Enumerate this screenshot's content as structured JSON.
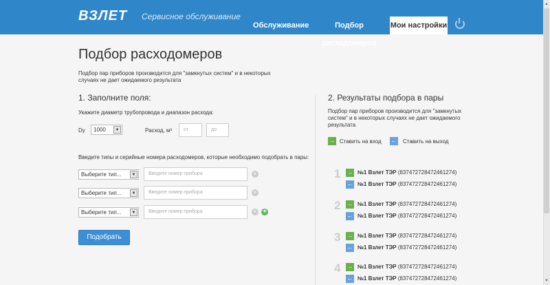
{
  "header": {
    "logo": "ВЗЛЕТ",
    "subtitle": "Сервисное обслуживание",
    "nav": [
      "Обслуживание",
      "Подбор расходомеров",
      "Мои настройки"
    ],
    "active_nav": "Мои настройки"
  },
  "page": {
    "title": "Подбор расходомеров",
    "lead": "Подбор пар приборов производится для \"замкнутых систем\" и в некоторых случаях не дает ожидаемого результата"
  },
  "left": {
    "heading": "1. Заполните поля:",
    "diameter_prompt": "Укажите диаметр трубопровода и диапазон расхода:",
    "dy_label": "Dy",
    "dy_value": "1000",
    "flow_label": "Расход, м³",
    "from_placeholder": "от",
    "to_placeholder": "до",
    "types_prompt": "Введите типы и серийные номера расходомеров, которые необходимо подобрать в пары:",
    "rows": [
      {
        "type": "Выберите тип...",
        "placeholder": "Введите номер прибора"
      },
      {
        "type": "Выберите тип...",
        "placeholder": "Введите номер прибора"
      },
      {
        "type": "Выберите тип...",
        "placeholder": "Введите номер прибора"
      }
    ],
    "clear_symbol": "×",
    "add_symbol": "+",
    "submit": "Подобрать"
  },
  "right": {
    "heading": "2. Результаты подбора в пары",
    "note": "Подбор пар приборов производится для \"замкнутых систем\" и в некоторых случаях не дает ожидаемого результата",
    "legend_in": "Ставить на вход",
    "legend_out": "Ставить на выход",
    "in_arrow": "→",
    "out_arrow": "←",
    "pairs": [
      {
        "num": "1",
        "in_name": "№1 Взлет ТЭР",
        "in_serial": "(837472728472461274)",
        "out_name": "№1 Взлет ТЭР",
        "out_serial": "(837472728472461274)"
      },
      {
        "num": "2",
        "in_name": "№1 Взлет ТЭР",
        "in_serial": "(837472728472461274)",
        "out_name": "№1 Взлет ТЭР",
        "out_serial": "(837472728472461274)"
      },
      {
        "num": "3",
        "in_name": "№1 Взлет ТЭР",
        "in_serial": "(837472728472461274)",
        "out_name": "№1 Взлет ТЭР",
        "out_serial": "(837472728472461274)"
      },
      {
        "num": "4",
        "in_name": "№1 Взлет ТЭР",
        "in_serial": "(837472728472461274)",
        "out_name": "№1 Взлет ТЭР",
        "out_serial": "(837472728472461274)"
      }
    ]
  },
  "colors": {
    "header_bg": "#2f86c9",
    "in_green": "#6ab04c",
    "out_blue": "#6aa1dc",
    "button_blue": "#3c8fd6"
  },
  "icons": {
    "power": "power-icon",
    "clear": "clear-icon",
    "add": "add-icon",
    "in": "arrow-right-icon",
    "out": "arrow-left-icon",
    "select": "chevron-down-icon"
  }
}
